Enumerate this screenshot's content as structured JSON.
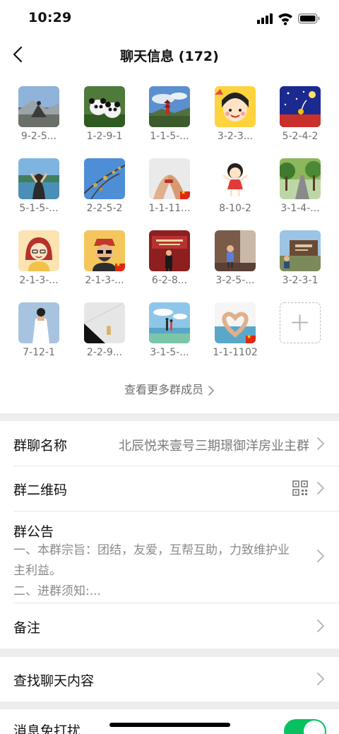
{
  "status": {
    "time": "10:29"
  },
  "nav": {
    "title": "聊天信息 (172)"
  },
  "members": [
    {
      "name": "9-2-5...",
      "avatar": "mountain-person-photo",
      "flag": false
    },
    {
      "name": "1-2-9-1",
      "avatar": "panda-photo",
      "flag": false
    },
    {
      "name": "1-1-5-...",
      "avatar": "pagoda-landscape-photo",
      "flag": false
    },
    {
      "name": "3-2-3...",
      "avatar": "cartoon-girl-photo",
      "flag": false
    },
    {
      "name": "5-2-4-2",
      "avatar": "night-sky-drawing",
      "flag": false
    },
    {
      "name": "5-1-5-...",
      "avatar": "woman-at-lake-photo",
      "flag": false
    },
    {
      "name": "2-2-5-2",
      "avatar": "branches-sky-photo",
      "flag": false
    },
    {
      "name": "1-1-11...",
      "avatar": "holding-hands-photo",
      "flag": true
    },
    {
      "name": "8-10-2",
      "avatar": "cartoon-girl-jumping",
      "flag": false
    },
    {
      "name": "3-1-4-...",
      "avatar": "tree-road-photo",
      "flag": false
    },
    {
      "name": "2-1-3-...",
      "avatar": "cartoon-woman-avatar",
      "flag": false
    },
    {
      "name": "2-1-3-...",
      "avatar": "cartoon-man-avatar",
      "flag": true
    },
    {
      "name": "6-2-8...",
      "avatar": "stage-speaker-photo",
      "flag": false
    },
    {
      "name": "3-2-5-...",
      "avatar": "child-indoor-photo",
      "flag": false
    },
    {
      "name": "3-2-3-1",
      "avatar": "farm-sign-photo",
      "flag": false
    },
    {
      "name": "7-12-1",
      "avatar": "man-white-shirt-illustration",
      "flag": false
    },
    {
      "name": "2-2-9...",
      "avatar": "wall-shadow-photo",
      "flag": false
    },
    {
      "name": "3-1-5-...",
      "avatar": "beach-couple-photo",
      "flag": false
    },
    {
      "name": "1-1-1102",
      "avatar": "heart-hands-photo",
      "flag": true
    }
  ],
  "more_members": "查看更多群成员",
  "settings": {
    "group_name": {
      "label": "群聊名称",
      "value": "北辰悦来壹号三期璟御洋房业主群"
    },
    "qr_code": {
      "label": "群二维码"
    },
    "announcement": {
      "label": "群公告",
      "line1": "一、本群宗旨：团结，友爱，互帮互助，力致维护业",
      "line2": "主利益。",
      "line3": "二、进群须知:..."
    },
    "remark": {
      "label": "备注"
    },
    "search_history": {
      "label": "查找聊天内容"
    },
    "mute": {
      "label": "消息免打扰",
      "enabled": true
    }
  }
}
